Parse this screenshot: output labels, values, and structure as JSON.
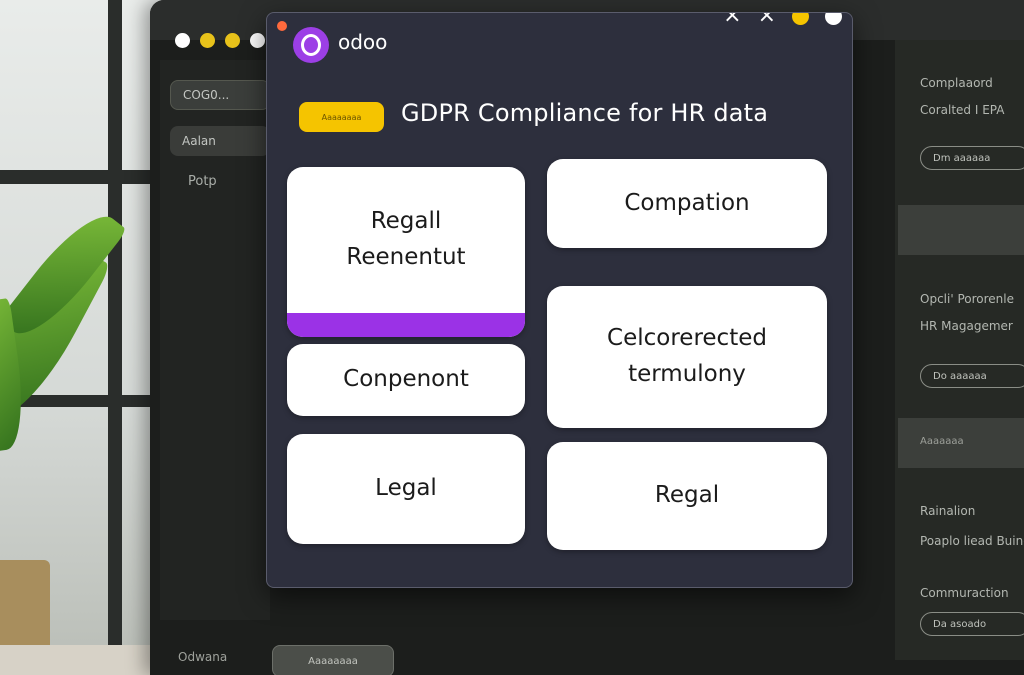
{
  "background": {
    "sidebar": {
      "item1": "COG0...",
      "item2": "Aalan",
      "item3": "Potp"
    },
    "right_panel": {
      "section1_line1": "Complaaord",
      "section1_line2": "Coralted I EPA",
      "section1_pill": "Dm aaaaaa",
      "section2_line1": "Opcli' Pororenle",
      "section2_line2": "HR Magagemer",
      "section2_pill": "Do aaaaaa",
      "band2_label": "Aaaaaaa",
      "section3_line1": "Rainalion",
      "section3_line2": "Poaplo liead Buing",
      "section4_line1": "Commuraction",
      "section4_pill": "Da asoado"
    },
    "footer": {
      "label": "Odwana",
      "pill": "Aaaaaaaa"
    }
  },
  "dialog": {
    "brand": "odoo",
    "controls": [
      "×",
      "×"
    ],
    "badge": "Aaaaaaaa",
    "title": "GDPR Compliance  for HR  data",
    "cards": [
      {
        "text": "Regall\nReenentut",
        "accent": true
      },
      {
        "text": "Compation",
        "accent": false
      },
      {
        "text": "Conpenont",
        "accent": false
      },
      {
        "text": "Celcorerected\ntermulony",
        "accent": false
      },
      {
        "text": "Legal",
        "accent": false
      },
      {
        "text": "Regal",
        "accent": false
      }
    ]
  },
  "colors": {
    "dialog_bg": "#2d2f3d",
    "brand": "#9c3fe6",
    "badge": "#f5c400",
    "accent": "#9b32e6"
  }
}
